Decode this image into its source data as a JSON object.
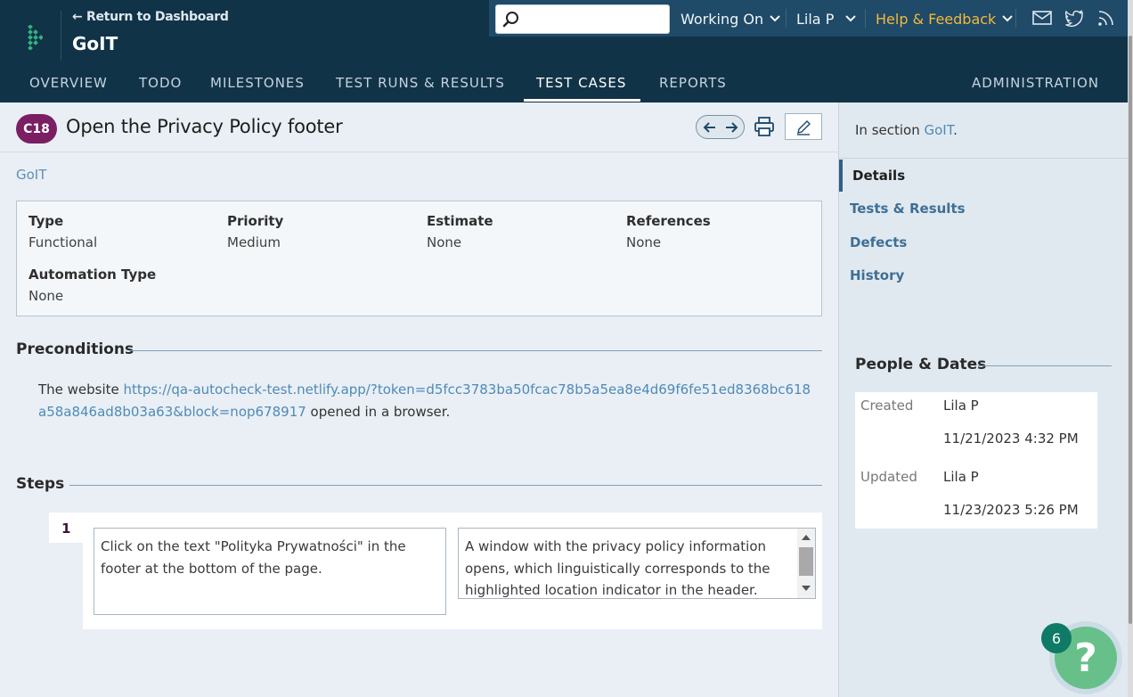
{
  "header": {
    "return_link": "← Return to Dashboard",
    "project_name": "GoIT",
    "search": {
      "placeholder": ""
    },
    "working_on": "Working On",
    "user": "Lila P",
    "help": "Help & Feedback"
  },
  "nav": {
    "tabs": [
      {
        "label": "OVERVIEW"
      },
      {
        "label": "TODO"
      },
      {
        "label": "MILESTONES"
      },
      {
        "label": "TEST RUNS & RESULTS"
      },
      {
        "label": "TEST CASES",
        "active": true
      },
      {
        "label": "REPORTS"
      },
      {
        "label": "ADMINISTRATION"
      }
    ]
  },
  "case": {
    "id": "C18",
    "title": "Open the Privacy Policy footer",
    "section": "GoIT",
    "properties": {
      "type_label": "Type",
      "type_value": "Functional",
      "priority_label": "Priority",
      "priority_value": "Medium",
      "estimate_label": "Estimate",
      "estimate_value": "None",
      "references_label": "References",
      "references_value": "None",
      "automation_label": "Automation Type",
      "automation_value": "None"
    },
    "preconditions": {
      "heading": "Preconditions",
      "prefix": "The website ",
      "link": "https://qa-autocheck-test.netlify.app/?token=d5fcc3783ba50fcac78b5a5ea8e4d69f6fe51ed8368bc618a58a846ad8b03a63&block=nop678917",
      "suffix": " opened in a browser."
    },
    "steps": {
      "heading": "Steps",
      "items": [
        {
          "number": "1",
          "content": "Click on the text \"Polityka Prywatności\" in the footer at the bottom of the page.",
          "expected": "A window with the privacy policy information opens, which linguistically corresponds to the highlighted location indicator in the header."
        }
      ]
    }
  },
  "sidebar": {
    "section_prefix": "In section ",
    "section_link": "GoIT",
    "section_suffix": ".",
    "items": [
      {
        "label": "Details",
        "active": true
      },
      {
        "label": "Tests & Results"
      },
      {
        "label": "Defects"
      },
      {
        "label": "History"
      }
    ],
    "people_heading": "People & Dates",
    "created_label": "Created",
    "created_by": "Lila P",
    "created_date": "11/21/2023 4:32 PM",
    "updated_label": "Updated",
    "updated_by": "Lila P",
    "updated_date": "11/23/2023 5:26 PM"
  },
  "help_widget": {
    "count": "6",
    "glyph": "?"
  },
  "colors": {
    "header_bg": "#113348",
    "accent": "#4f8ab6",
    "badge": "#7a1f63",
    "help_text": "#f3b83a"
  }
}
